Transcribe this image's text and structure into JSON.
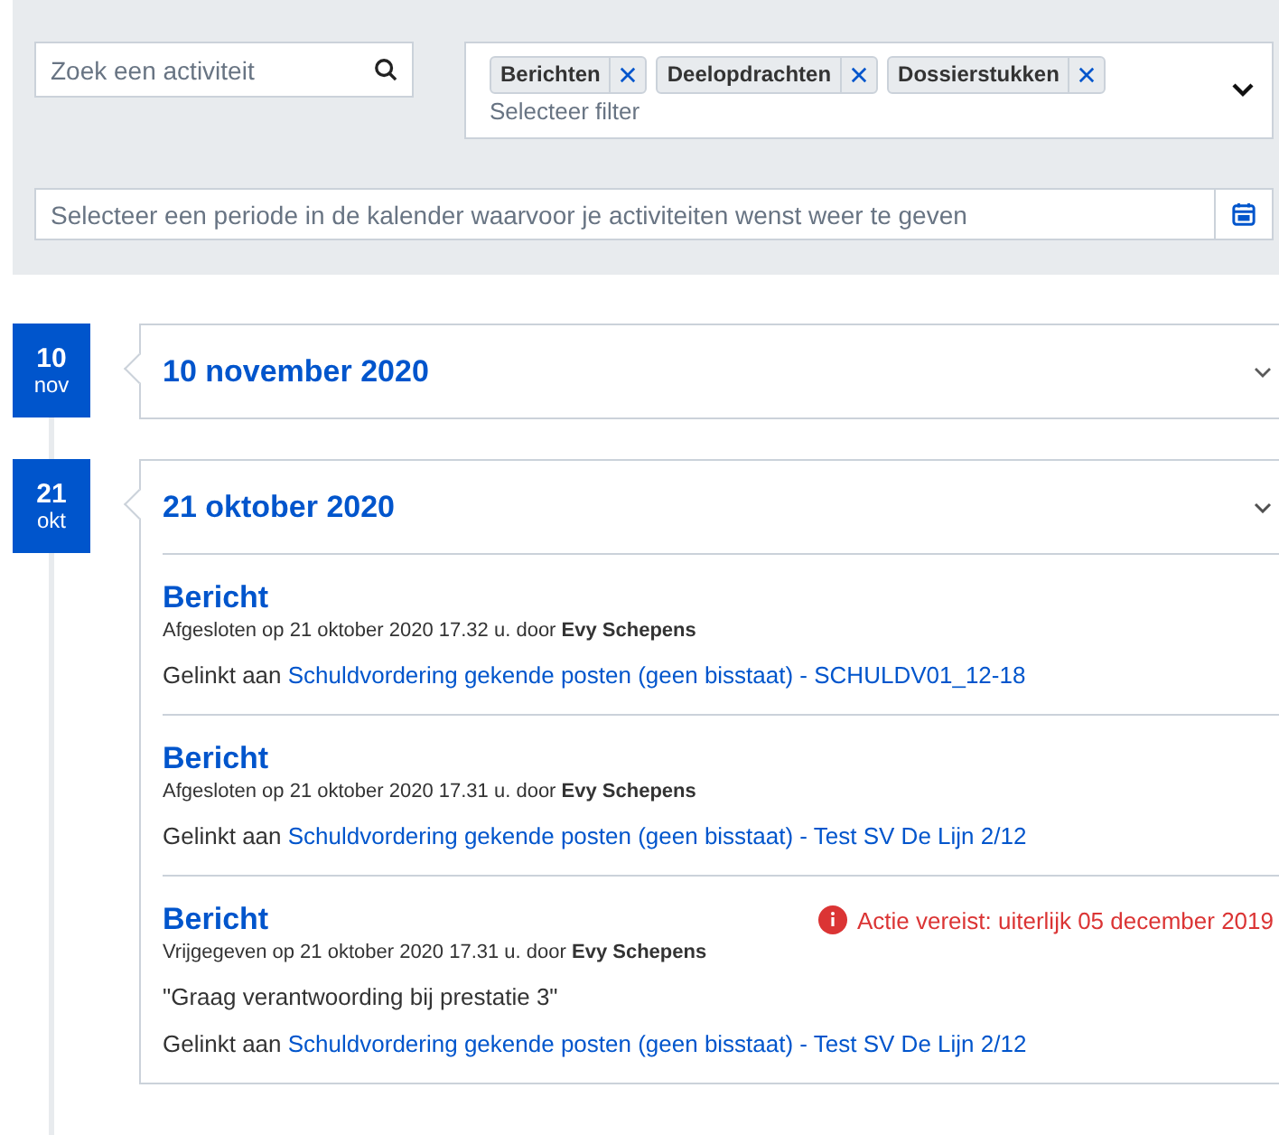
{
  "search": {
    "placeholder": "Zoek een activiteit"
  },
  "filter": {
    "tags": [
      "Berichten",
      "Deelopdrachten",
      "Dossierstukken"
    ],
    "placeholder": "Selecteer filter"
  },
  "period": {
    "placeholder": "Selecteer een periode in de kalender waarvoor je activiteiten wenst weer te geven"
  },
  "days": [
    {
      "day": "10",
      "month": "nov",
      "title": "10 november 2020",
      "expanded": false
    },
    {
      "day": "21",
      "month": "okt",
      "title": "21 oktober 2020",
      "expanded": true,
      "activities": [
        {
          "title": "Bericht",
          "meta": "Afgesloten op 21 oktober 2020 17.32 u. door **Evy Schepens**",
          "link_prefix": "Gelinkt aan",
          "link": "Schuldvordering gekende posten (geen bisstaat) - SCHULDV01_12-18"
        },
        {
          "title": "Bericht",
          "meta": "Afgesloten op 21 oktober 2020 17.31 u. door **Evy Schepens**",
          "link_prefix": "Gelinkt aan",
          "link": "Schuldvordering gekende posten (geen bisstaat) - Test SV De Lijn 2/12"
        },
        {
          "title": "Bericht",
          "alert": "Actie vereist: uiterlijk 05 december 2019",
          "meta": "Vrijgegeven op 21 oktober 2020 17.31 u. door **Evy Schepens**",
          "quote": "\"Graag verantwoording bij prestatie 3\"",
          "link_prefix": "Gelinkt aan",
          "link": "Schuldvordering gekende posten (geen bisstaat) - Test SV De Lijn 2/12"
        }
      ]
    }
  ]
}
